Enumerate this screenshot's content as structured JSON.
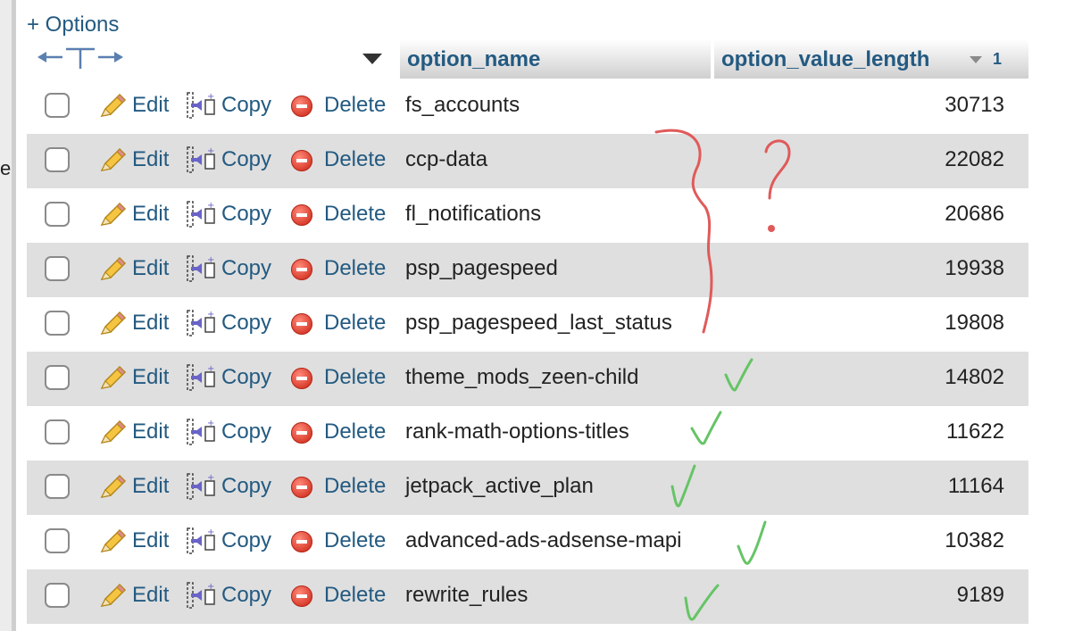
{
  "options_link": "+ Options",
  "columns": {
    "option_name": "option_name",
    "option_value_length": "option_value_length",
    "sort_order": "1"
  },
  "actions": {
    "edit": "Edit",
    "copy": "Copy",
    "delete": "Delete"
  },
  "left_edge_text": "e",
  "rows": [
    {
      "option_name": "fs_accounts",
      "option_value_length": "30713",
      "checked": false
    },
    {
      "option_name": "ccp-data",
      "option_value_length": "22082",
      "checked": false
    },
    {
      "option_name": "fl_notifications",
      "option_value_length": "20686",
      "checked": false
    },
    {
      "option_name": "psp_pagespeed",
      "option_value_length": "19938",
      "checked": false
    },
    {
      "option_name": "psp_pagespeed_last_status",
      "option_value_length": "19808",
      "checked": false
    },
    {
      "option_name": "theme_mods_zeen-child",
      "option_value_length": "14802",
      "checked": false
    },
    {
      "option_name": "rank-math-options-titles",
      "option_value_length": "11622",
      "checked": false
    },
    {
      "option_name": "jetpack_active_plan",
      "option_value_length": "11164",
      "checked": false
    },
    {
      "option_name": "advanced-ads-adsense-mapi",
      "option_value_length": "10382",
      "checked": false
    },
    {
      "option_name": "rewrite_rules",
      "option_value_length": "9189",
      "checked": false
    }
  ],
  "annotations": {
    "bracket_color": "#e05a5a",
    "question_mark": "?",
    "check_color": "#66c466"
  }
}
